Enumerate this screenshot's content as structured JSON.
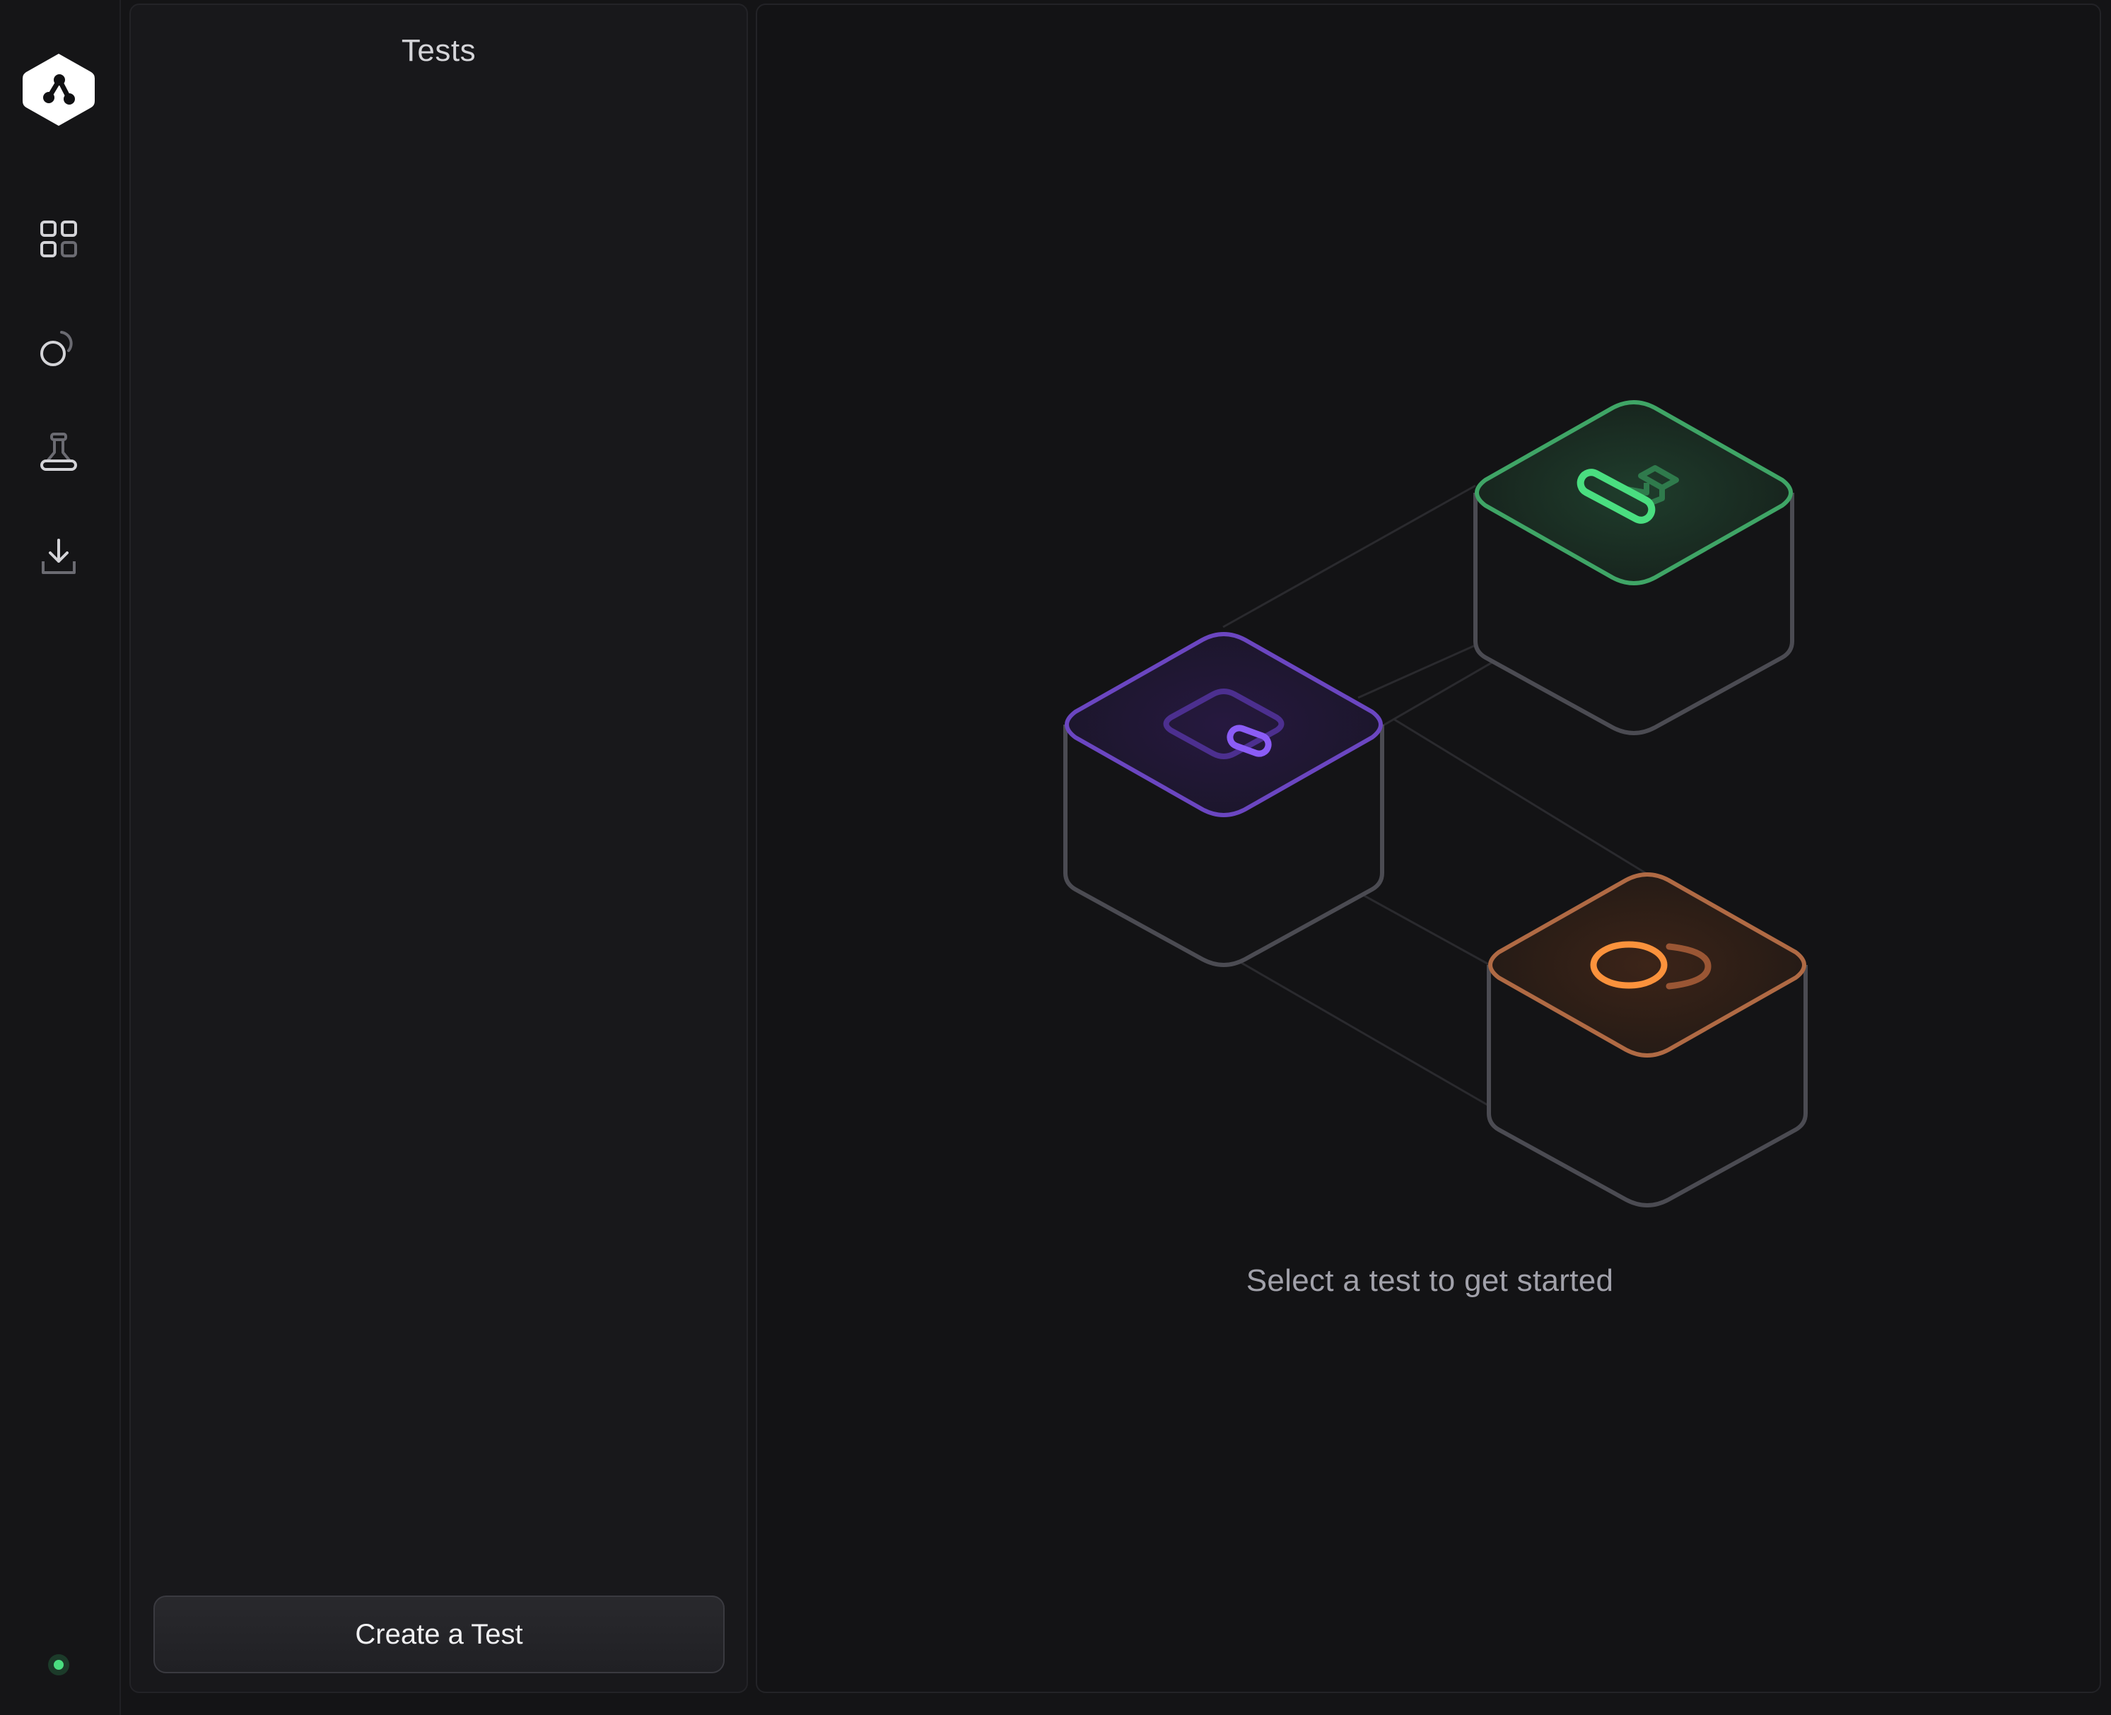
{
  "sidebar": {
    "logo": "app-logo",
    "items": [
      {
        "name": "dashboard",
        "icon": "grid-icon"
      },
      {
        "name": "runs",
        "icon": "runs-icon"
      },
      {
        "name": "tests",
        "icon": "flask-icon"
      },
      {
        "name": "downloads",
        "icon": "download-icon"
      }
    ],
    "status_color": "#4ade80"
  },
  "tests_panel": {
    "title": "Tests",
    "create_button": "Create a Test"
  },
  "main": {
    "empty_state": "Select a test to get started",
    "accent_colors": {
      "green": "#4ade80",
      "purple": "#8b5cf6",
      "orange": "#fb923c"
    }
  }
}
